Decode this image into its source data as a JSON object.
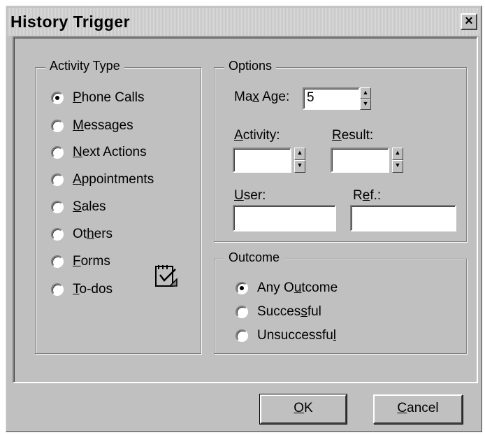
{
  "window": {
    "title": "History Trigger",
    "close_glyph": "×"
  },
  "activity_type": {
    "legend": "Activity Type",
    "items": [
      {
        "pre": "",
        "ul": "P",
        "post": "hone Calls",
        "checked": true
      },
      {
        "pre": "",
        "ul": "M",
        "post": "essages",
        "checked": false
      },
      {
        "pre": "",
        "ul": "N",
        "post": "ext Actions",
        "checked": false
      },
      {
        "pre": "",
        "ul": "A",
        "post": "ppointments",
        "checked": false
      },
      {
        "pre": "",
        "ul": "S",
        "post": "ales",
        "checked": false
      },
      {
        "pre": "Ot",
        "ul": "h",
        "post": "ers",
        "checked": false
      },
      {
        "pre": "",
        "ul": "F",
        "post": "orms",
        "checked": false
      },
      {
        "pre": "",
        "ul": "T",
        "post": "o-dos",
        "checked": false
      }
    ],
    "icon": "notepad-check-icon"
  },
  "options": {
    "legend": "Options",
    "max_age": {
      "pre": "Ma",
      "ul": "x",
      "post": " Age:",
      "value": "5"
    },
    "activity": {
      "pre": "",
      "ul": "A",
      "post": "ctivity:",
      "value": ""
    },
    "result": {
      "pre": "",
      "ul": "R",
      "post": "esult:",
      "value": ""
    },
    "user": {
      "pre": "",
      "ul": "U",
      "post": "ser:",
      "value": ""
    },
    "ref": {
      "pre": "R",
      "ul": "e",
      "post": "f.:",
      "value": ""
    }
  },
  "outcome": {
    "legend": "Outcome",
    "items": [
      {
        "pre": "Any O",
        "ul": "u",
        "post": "tcome",
        "checked": true
      },
      {
        "pre": "Succes",
        "ul": "s",
        "post": "ful",
        "checked": false
      },
      {
        "pre": "Unsuccessfu",
        "ul": "l",
        "post": "",
        "checked": false
      }
    ]
  },
  "buttons": {
    "ok": {
      "pre": "",
      "ul": "O",
      "post": "K"
    },
    "cancel": {
      "pre": "",
      "ul": "C",
      "post": "ancel"
    }
  }
}
